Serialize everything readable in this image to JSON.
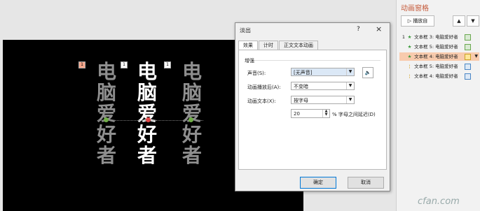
{
  "slide": {
    "columns": [
      {
        "chars": [
          "电",
          "脑",
          "爱",
          "好",
          "者"
        ],
        "color": "#8e8e8e",
        "tag": "1",
        "tag_color": "#f4a58a"
      },
      {
        "chars": [
          "电",
          "脑",
          "爱",
          "好",
          "者"
        ],
        "color": "#ffffff",
        "tag": "1",
        "tag_color": "#ffffff"
      },
      {
        "chars": [
          "电",
          "脑",
          "爱",
          "好",
          "者"
        ],
        "color": "#8e8e8e",
        "tag": "1",
        "tag_color": "#ffffff"
      }
    ]
  },
  "dialog": {
    "title": "淡出",
    "help": "?",
    "close": "×",
    "tabs": [
      "效果",
      "计时",
      "正文文本动画"
    ],
    "section": "增强",
    "sound_label": "声音(S):",
    "sound_value": "[无声音]",
    "after_label": "动画播放后(A):",
    "after_value": "不变暗",
    "text_label": "动画文本(X):",
    "text_value": "按字母",
    "delay_value": "20",
    "delay_label": "% 字母之间延迟(D)",
    "ok": "确定",
    "cancel": "取消"
  },
  "pane": {
    "title": "动画窗格",
    "play": "播放自",
    "up": "▲",
    "down": "▼",
    "items": [
      {
        "num": "1",
        "icon": "★",
        "label": "文本框 3: 电脑爱好者",
        "highlight": false
      },
      {
        "num": "",
        "icon": "★",
        "label": "文本框 5: 电脑爱好者",
        "highlight": false
      },
      {
        "num": "",
        "icon": "★",
        "label": "文本框 4: 电脑爱好者",
        "highlight": true
      },
      {
        "num": "",
        "icon": "¦",
        "label": "文本框 5: 电脑爱好者",
        "highlight": false
      },
      {
        "num": "",
        "icon": "¦",
        "label": "文本框 4: 电脑爱好者",
        "highlight": false
      }
    ]
  },
  "watermark": "cfan.com"
}
